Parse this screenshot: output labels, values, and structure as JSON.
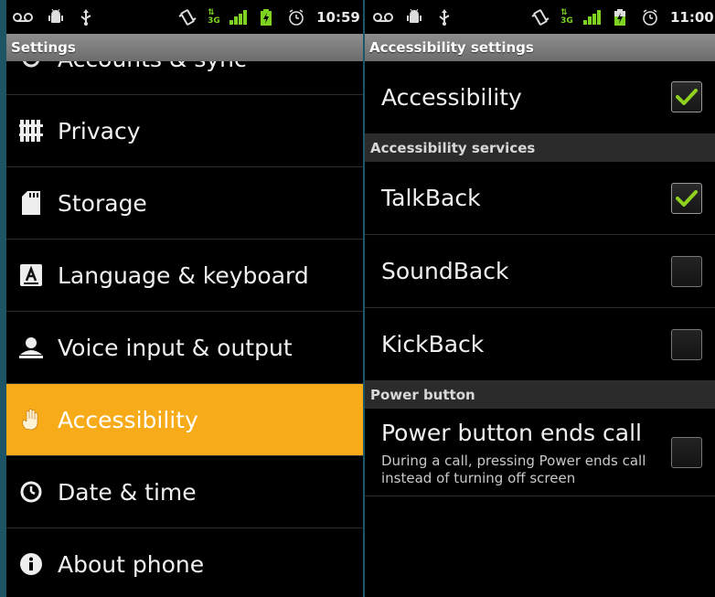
{
  "left_screen": {
    "status_bar": {
      "time": "10:59",
      "icons": [
        "voicemail-icon",
        "android-debug-icon",
        "usb-icon",
        "vibrate-icon",
        "3g-icon",
        "signal-icon",
        "battery-charging-icon",
        "alarm-icon"
      ]
    },
    "title": "Settings",
    "items": [
      {
        "label": "Accounts & sync",
        "icon": "sync-icon",
        "selected": false
      },
      {
        "label": "Privacy",
        "icon": "privacy-icon",
        "selected": false
      },
      {
        "label": "Storage",
        "icon": "sd-card-icon",
        "selected": false
      },
      {
        "label": "Language & keyboard",
        "icon": "language-icon",
        "selected": false
      },
      {
        "label": "Voice input & output",
        "icon": "voice-icon",
        "selected": false
      },
      {
        "label": "Accessibility",
        "icon": "hand-icon",
        "selected": true
      },
      {
        "label": "Date & time",
        "icon": "clock-icon",
        "selected": false
      },
      {
        "label": "About phone",
        "icon": "info-icon",
        "selected": false
      }
    ]
  },
  "right_screen": {
    "status_bar": {
      "time": "11:00"
    },
    "title": "Accessibility settings",
    "accessibility": {
      "label": "Accessibility",
      "checked": true
    },
    "services_header": "Accessibility services",
    "services": [
      {
        "label": "TalkBack",
        "checked": true
      },
      {
        "label": "SoundBack",
        "checked": false
      },
      {
        "label": "KickBack",
        "checked": false
      }
    ],
    "power_header": "Power button",
    "power": {
      "label": "Power button ends call",
      "summary_line1": "During a call, pressing Power ends call",
      "summary_line2": "instead of turning off screen",
      "checked": false
    }
  },
  "colors": {
    "selection": "#f8ab18",
    "check": "#8ed11e",
    "background": "#000000"
  }
}
